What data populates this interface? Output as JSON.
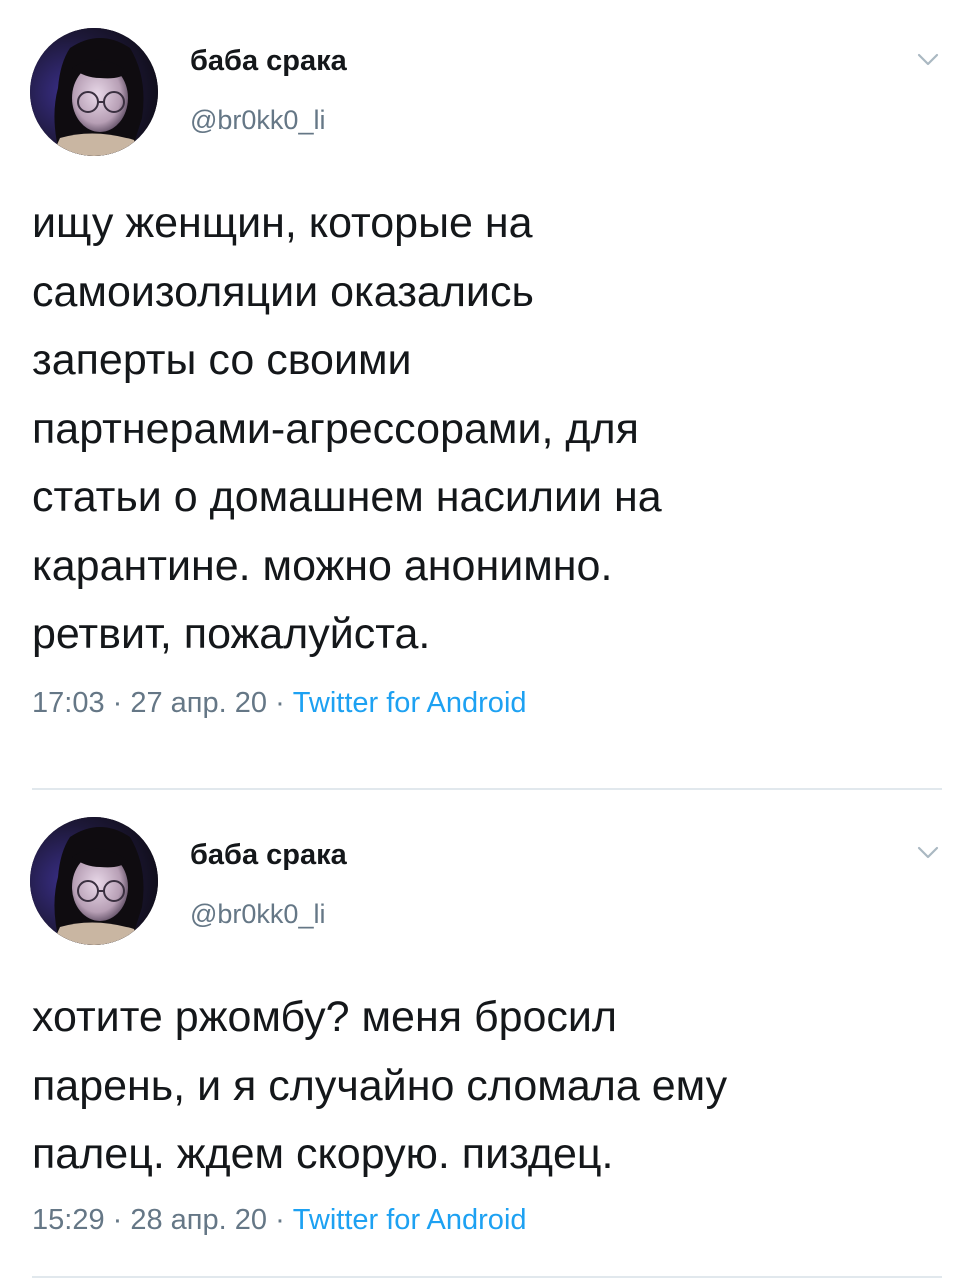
{
  "tweets": [
    {
      "display_name": "баба срака",
      "handle": "@br0kk0_li",
      "text_lines": [
        "ищу женщин, которые на",
        "самоизоляции оказались",
        "заперты со своими",
        "партнерами-агрессорами, для",
        "статьи о домашнем насилии на",
        "карантине. можно анонимно.",
        "ретвит, пожалуйста."
      ],
      "time": "17:03",
      "date": "27 апр. 20",
      "separator": " · ",
      "source": "Twitter for Android",
      "avatar_icon": "user-avatar-photo",
      "more_icon": "chevron-down-icon"
    },
    {
      "display_name": "баба срака",
      "handle": "@br0kk0_li",
      "text_lines": [
        "хотите ржомбу? меня бросил",
        "парень, и я случайно сломала ему",
        "палец. ждем скорую. пиздец."
      ],
      "time": "15:29",
      "date": "28 апр. 20",
      "separator": " · ",
      "source": "Twitter for Android",
      "avatar_icon": "user-avatar-photo",
      "more_icon": "chevron-down-icon"
    }
  ],
  "colors": {
    "text": "#14171a",
    "secondary": "#657786",
    "link": "#1da1f2",
    "divider": "#e1e8ed"
  }
}
